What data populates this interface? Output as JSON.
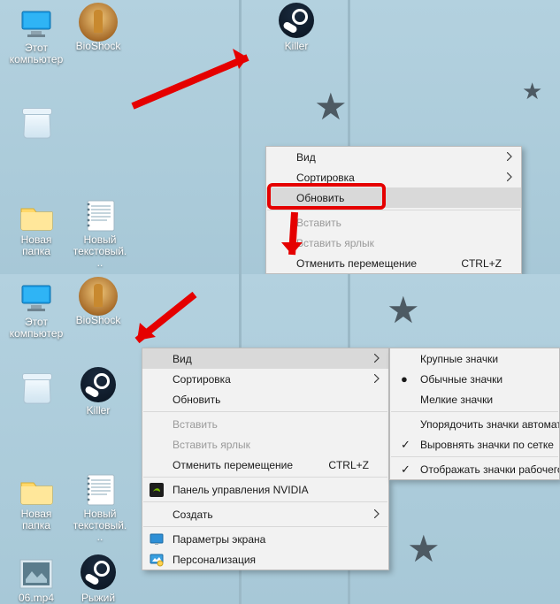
{
  "top": {
    "icons": {
      "computer": "Этот компьютер",
      "bioshock": "BioShock",
      "killer": "Killer",
      "recycle": "",
      "newFolder": "Новая папка",
      "newDoc": "Новый текстовый..."
    },
    "menu": {
      "view": "Вид",
      "sort": "Сортировка",
      "refresh": "Обновить",
      "paste": "Вставить",
      "pasteShortcut": "Вставить ярлык",
      "undoMove": "Отменить перемещение",
      "undoShortcut": "CTRL+Z"
    }
  },
  "bottom": {
    "icons": {
      "computer": "Этот компьютер",
      "bioshock": "BioShock",
      "recycle": "",
      "killer": "Killer",
      "newFolder": "Новая папка",
      "newDoc": "Новый текстовый...",
      "video": "06.mp4",
      "ryzhiy": "Рыжий"
    },
    "menu": {
      "view": "Вид",
      "sort": "Сортировка",
      "refresh": "Обновить",
      "paste": "Вставить",
      "pasteShortcut": "Вставить ярлык",
      "undoMove": "Отменить перемещение",
      "undoShortcut": "CTRL+Z",
      "nvidia": "Панель управления NVIDIA",
      "create": "Создать",
      "display": "Параметры экрана",
      "personalize": "Персонализация"
    },
    "submenu": {
      "large": "Крупные значки",
      "medium": "Обычные значки",
      "small": "Мелкие значки",
      "autoArrange": "Упорядочить значки автомат",
      "alignGrid": "Выровнять значки по сетке",
      "showIcons": "Отображать значки рабочего"
    }
  }
}
